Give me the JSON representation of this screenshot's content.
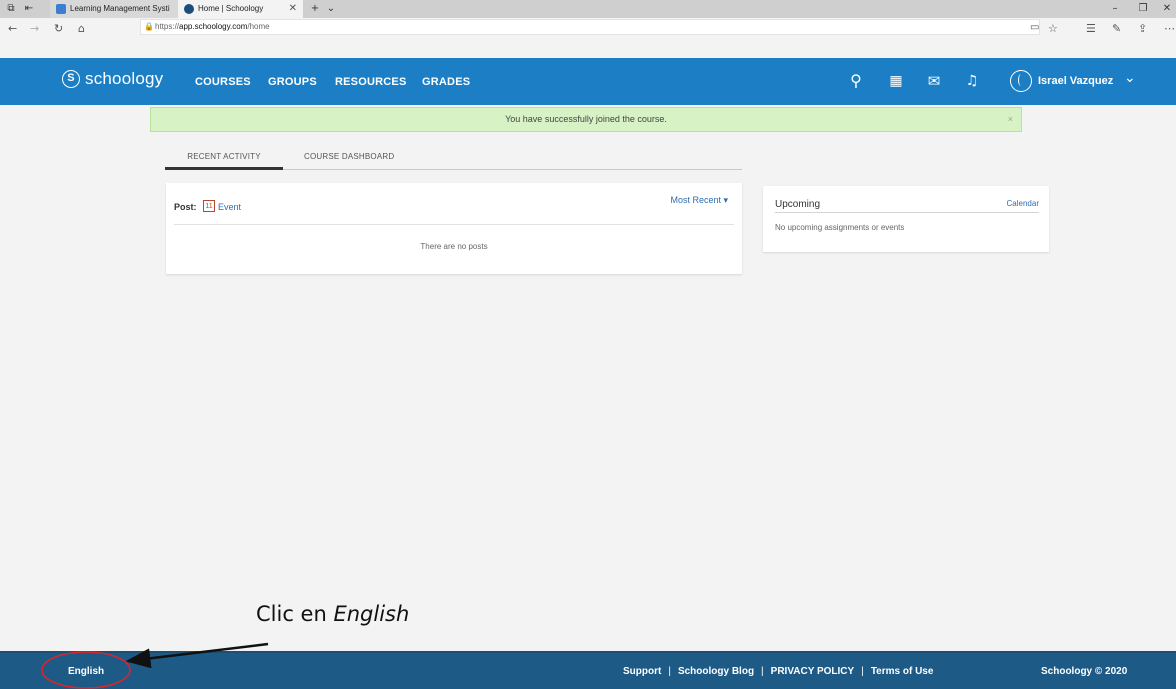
{
  "browser": {
    "tabs": [
      {
        "title": "Learning Management Systi"
      },
      {
        "title": "Home | Schoology"
      }
    ],
    "url_prefix": "https://",
    "url_host": "app.schoology.com",
    "url_path": "/home"
  },
  "header": {
    "logo_text": "schoology",
    "logo_mark": "S",
    "nav": [
      "COURSES",
      "GROUPS",
      "RESOURCES",
      "GRADES"
    ],
    "user_name": "Israel Vazquez",
    "icons": [
      "search-icon",
      "calendar-icon",
      "mail-icon",
      "bell-icon",
      "avatar-icon"
    ]
  },
  "banner": {
    "message": "You have successfully joined the course.",
    "close": "×"
  },
  "tabs": {
    "recent": "RECENT ACTIVITY",
    "dashboard": "COURSE DASHBOARD"
  },
  "feed": {
    "post_label": "Post:",
    "event_day": "11",
    "event_label": "Event",
    "sort_label": "Most Recent ▾",
    "empty_text": "There are no posts"
  },
  "upcoming": {
    "title": "Upcoming",
    "calendar_link": "Calendar",
    "empty_text": "No upcoming assignments or events"
  },
  "annotation": {
    "prefix": "Clic en ",
    "emphasis": "English",
    "color": "#d9262c"
  },
  "footer": {
    "language": "English",
    "links": [
      "Support",
      "Schoology Blog",
      "PRIVACY POLICY",
      "Terms of Use"
    ],
    "copyright": "Schoology © 2020"
  }
}
